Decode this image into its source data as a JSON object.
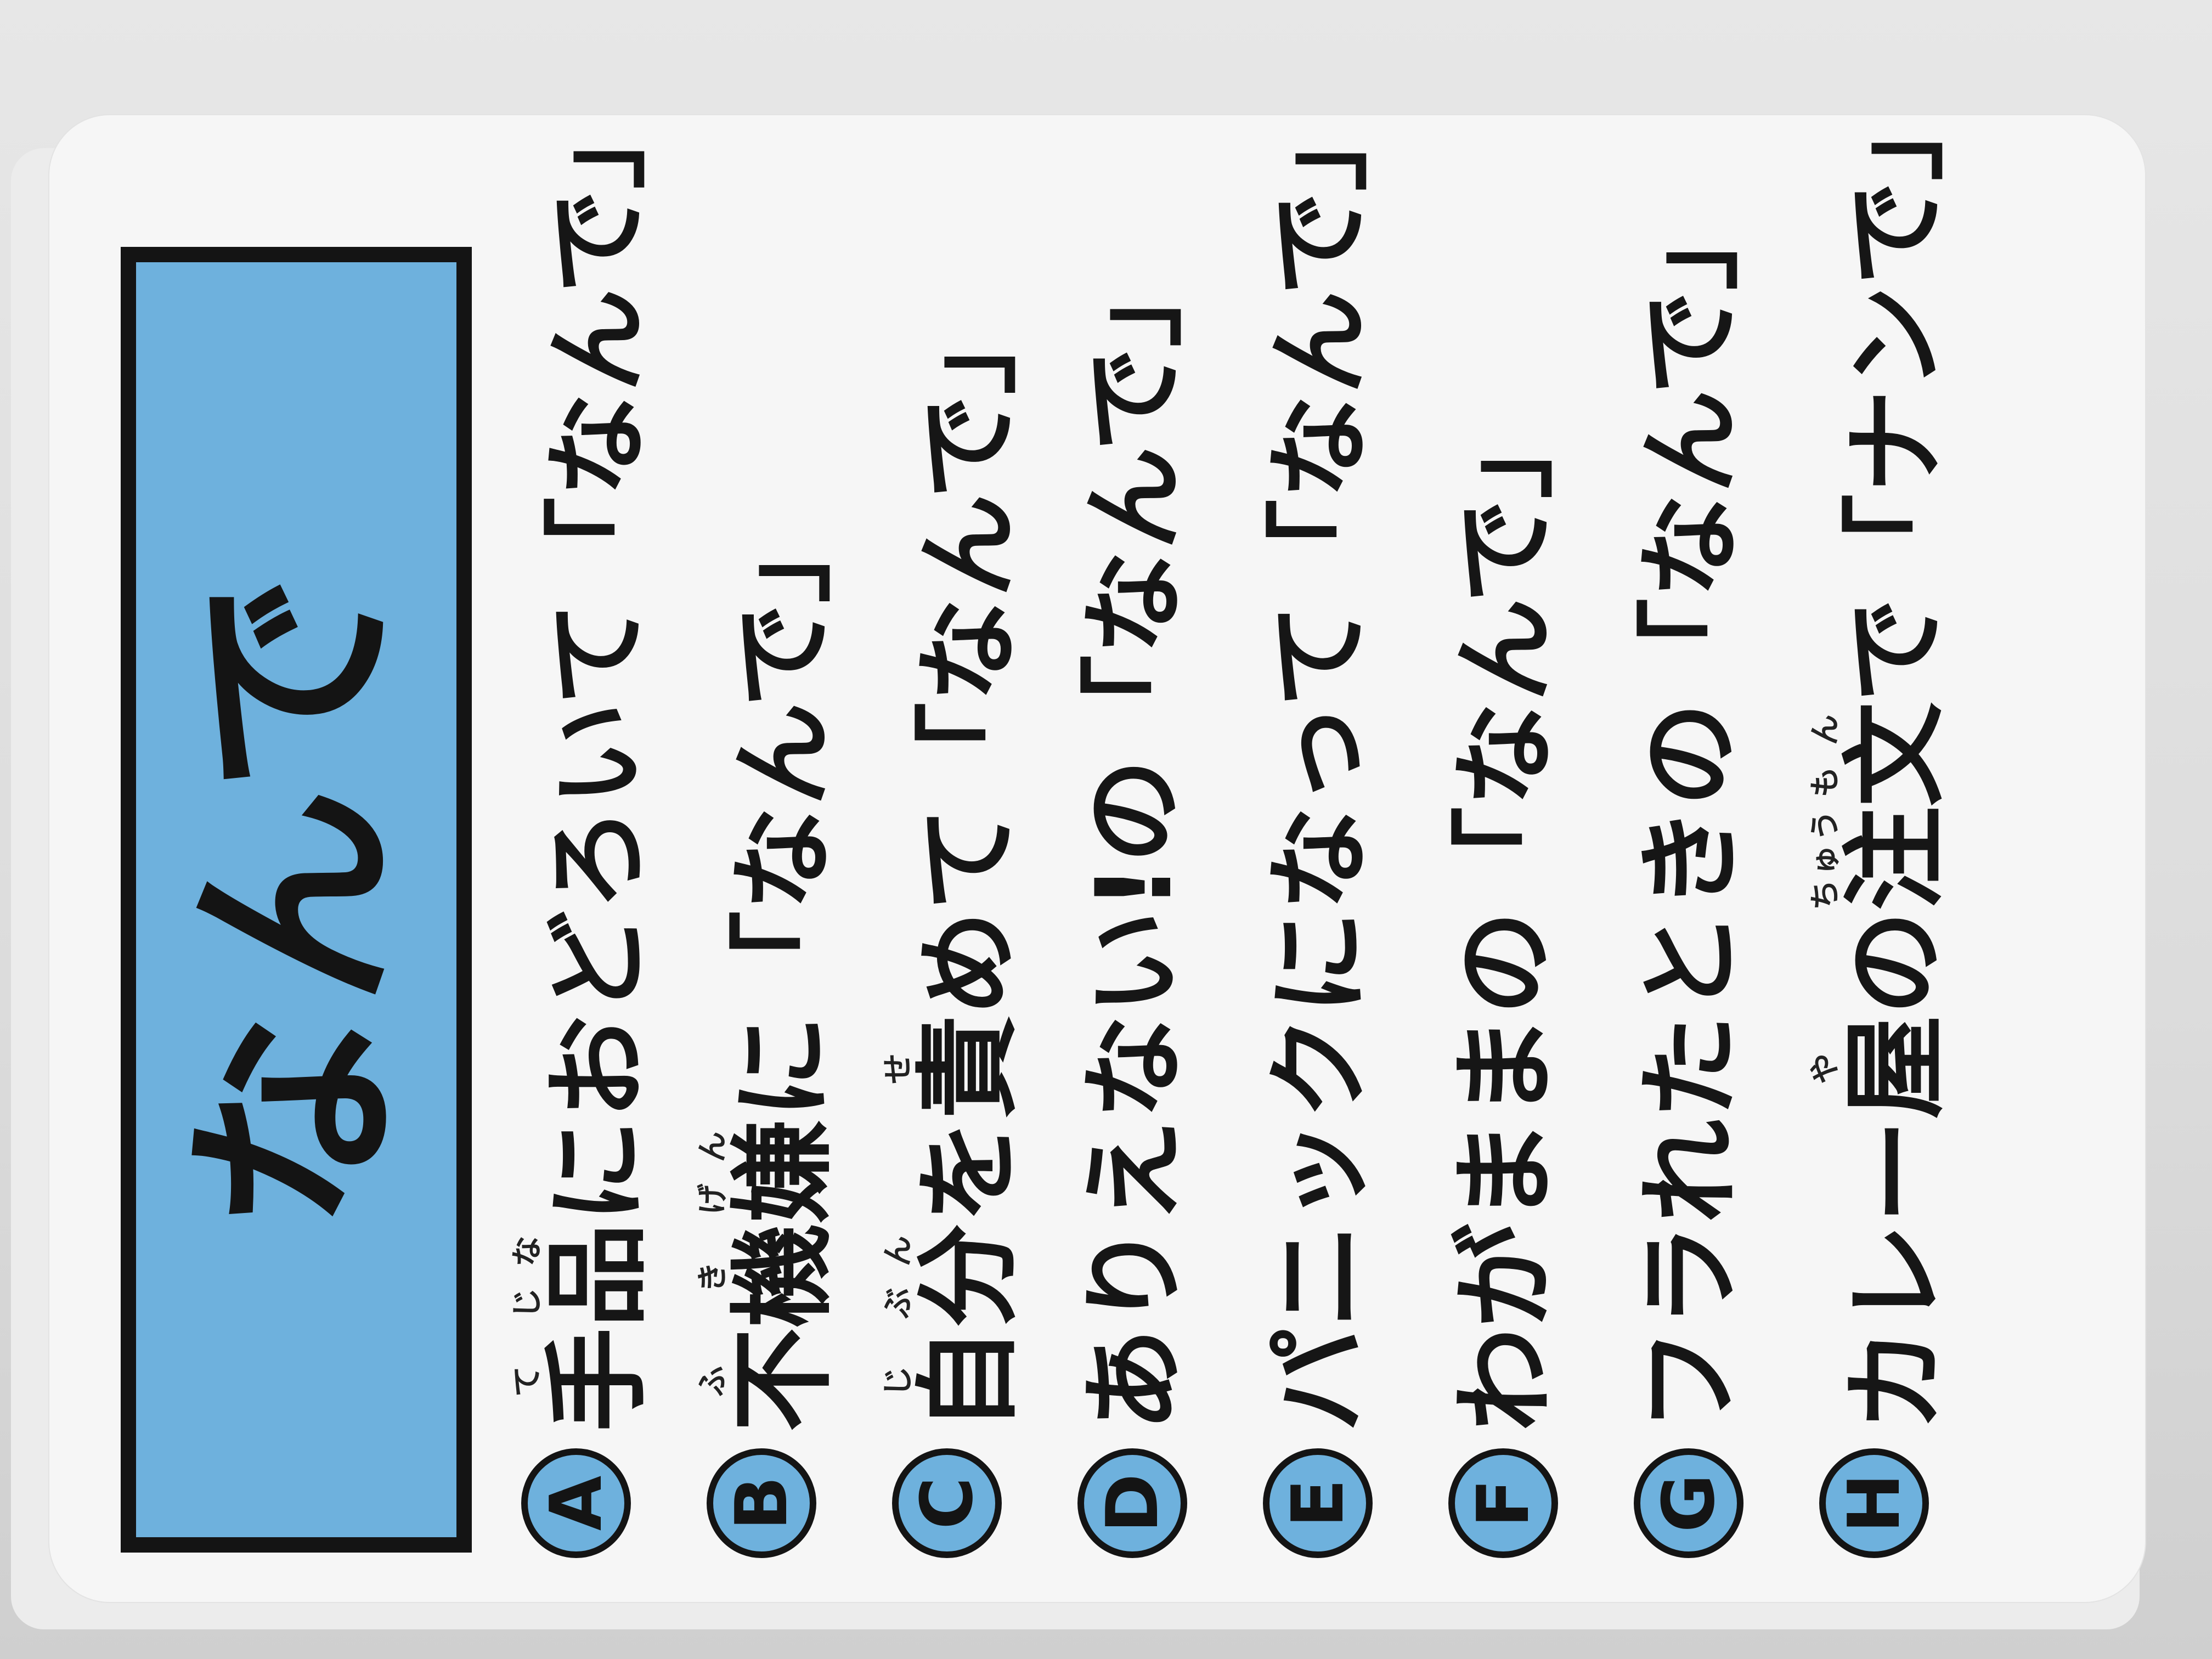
{
  "card": {
    "title": "なんで",
    "items": [
      {
        "letter": "A",
        "segments": [
          {
            "text": "手",
            "ruby": "て"
          },
          {
            "text": "品",
            "ruby": "じな"
          },
          {
            "text": "におどろいて「なんで」"
          }
        ]
      },
      {
        "letter": "B",
        "segments": [
          {
            "text": "不",
            "ruby": "ふ"
          },
          {
            "text": "機",
            "ruby": "き"
          },
          {
            "text": "嫌",
            "ruby": "げん"
          },
          {
            "text": "に「なんで」"
          }
        ]
      },
      {
        "letter": "C",
        "segments": [
          {
            "text": "自",
            "ruby": "じ"
          },
          {
            "text": "分",
            "ruby": "ぶん"
          },
          {
            "text": "を"
          },
          {
            "text": "責",
            "ruby": "せ"
          },
          {
            "text": "めて「なんで」"
          }
        ]
      },
      {
        "letter": "D",
        "segments": [
          {
            "text": "ありえない!の「なんで」"
          }
        ]
      },
      {
        "letter": "E",
        "segments": [
          {
            "text": "パニックになって「なんで」"
          }
        ]
      },
      {
        "letter": "F",
        "segments": [
          {
            "text": "わがままの「なんで」"
          }
        ]
      },
      {
        "letter": "G",
        "segments": [
          {
            "text": "フラれたときの「なんで」"
          }
        ]
      },
      {
        "letter": "H",
        "segments": [
          {
            "text": "カレー"
          },
          {
            "text": "屋",
            "ruby": "や"
          },
          {
            "text": "の"
          },
          {
            "text": "注",
            "ruby": "ちゅう"
          },
          {
            "text": "文",
            "ruby": "もん"
          },
          {
            "text": "で「ナンで」"
          }
        ]
      }
    ]
  },
  "colors": {
    "accent": "#6eb1dd",
    "ink": "#141414",
    "card": "#f6f6f6"
  }
}
